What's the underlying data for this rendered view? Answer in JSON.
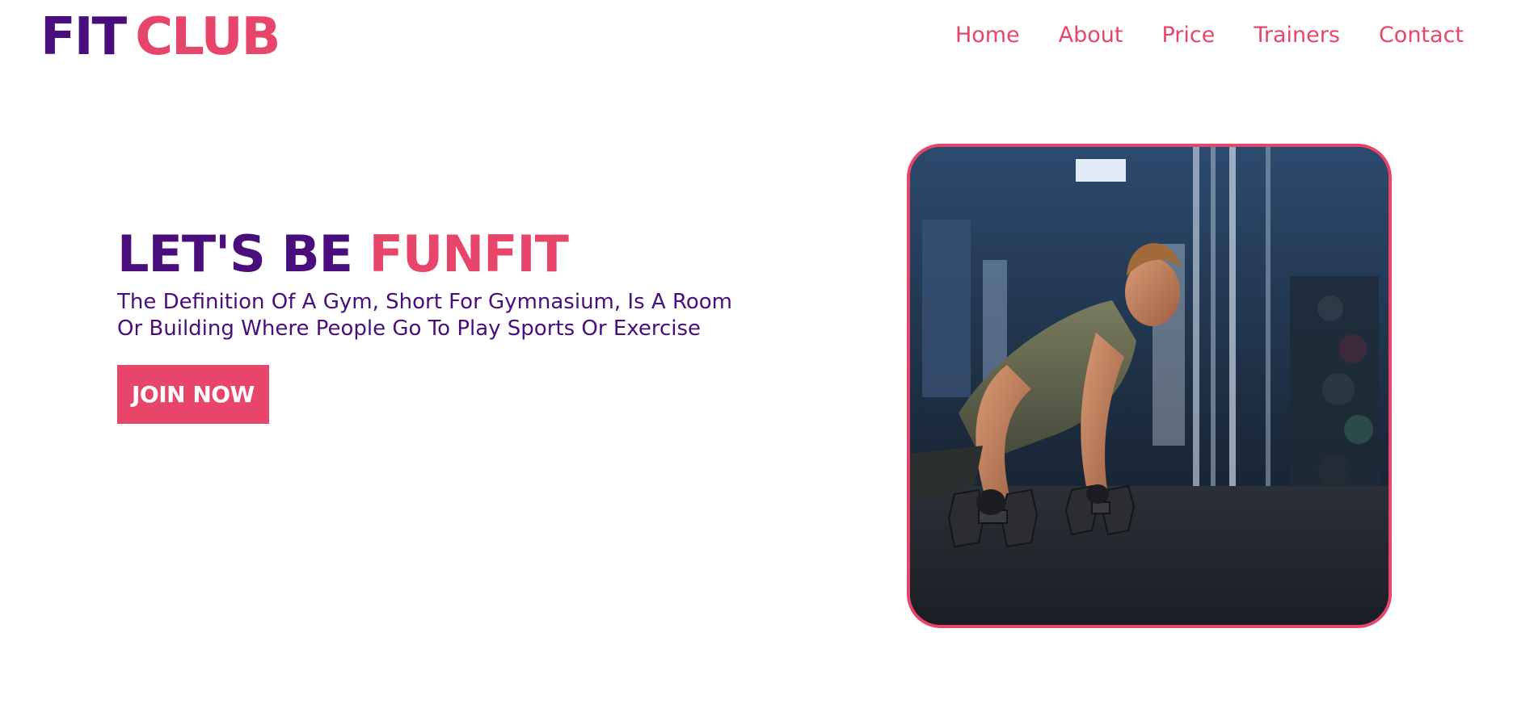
{
  "logo": {
    "part1": "FIT",
    "part2": "CLUB"
  },
  "nav": {
    "items": [
      {
        "label": "Home"
      },
      {
        "label": "About"
      },
      {
        "label": "Price"
      },
      {
        "label": "Trainers"
      },
      {
        "label": "Contact"
      }
    ]
  },
  "hero": {
    "title_part1": "LET'S BE",
    "title_part2": "FUNFIT",
    "description": "The Definition Of A Gym, Short For Gymnasium, Is A Room Or Building Where People Go To Play Sports Or Exercise",
    "cta_label": "JOIN NOW",
    "image_alt": "Man doing push-ups on dumbbells in a gym"
  },
  "colors": {
    "primary_purple": "#4a0e7c",
    "accent_pink": "#e8456a",
    "background": "#ffffff"
  }
}
